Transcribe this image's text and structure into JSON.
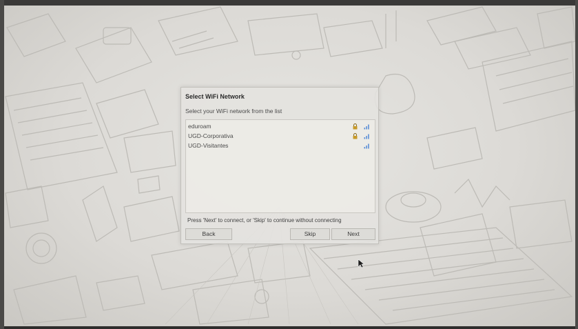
{
  "dialog": {
    "title": "Select WiFi Network",
    "subtitle": "Select your WiFi network from the list",
    "networks": [
      {
        "name": "eduroam",
        "secured": true,
        "signal_icon": "wifi-signal-icon"
      },
      {
        "name": "UGD-Corporativa",
        "secured": true,
        "signal_icon": "wifi-signal-icon"
      },
      {
        "name": "UGD-Visitantes",
        "secured": false,
        "signal_icon": "wifi-signal-icon"
      }
    ],
    "hint": "Press 'Next' to connect, or 'Skip' to continue without connecting",
    "buttons": {
      "back": "Back",
      "skip": "Skip",
      "next": "Next"
    }
  },
  "colors": {
    "lock": "#c79a2a",
    "signal": "#5b8fd6",
    "wallpaper_line": "#b9b7b2"
  }
}
